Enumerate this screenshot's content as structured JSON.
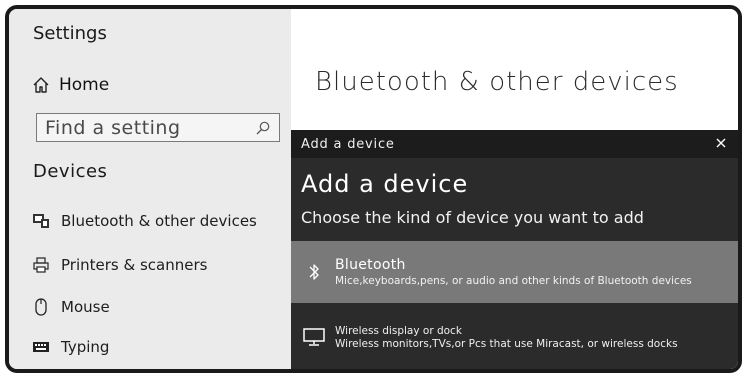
{
  "sidebar": {
    "title": "Settings",
    "home_label": "Home",
    "search_placeholder": "Find a setting",
    "section_title": "Devices",
    "items": [
      {
        "label": "Bluetooth & other devices",
        "icon": "bluetooth-devices-icon"
      },
      {
        "label": "Printers & scanners",
        "icon": "printer-icon"
      },
      {
        "label": "Mouse",
        "icon": "mouse-icon"
      },
      {
        "label": "Typing",
        "icon": "keyboard-icon"
      }
    ]
  },
  "main": {
    "title": "Bluetooth & other devices"
  },
  "dialog": {
    "window_title": "Add a device",
    "close_glyph": "×",
    "heading": "Add a device",
    "subtitle": "Choose the kind of device you want to add",
    "options": [
      {
        "name": "Bluetooth",
        "description": "Mice,keyboards,pens, or audio and other kinds of Bluetooth devices",
        "icon": "bluetooth-icon",
        "highlighted": true
      },
      {
        "name": "Wireless display or dock",
        "description": "Wireless monitors,TVs,or Pcs that use Miracast, or wireless docks",
        "icon": "monitor-icon",
        "highlighted": false
      }
    ]
  },
  "colors": {
    "sidebar_bg": "#ebebeb",
    "dialog_bg": "#2b2b2b",
    "dialog_titlebar_bg": "#1c1c1c",
    "option_highlight_bg": "#797979"
  }
}
